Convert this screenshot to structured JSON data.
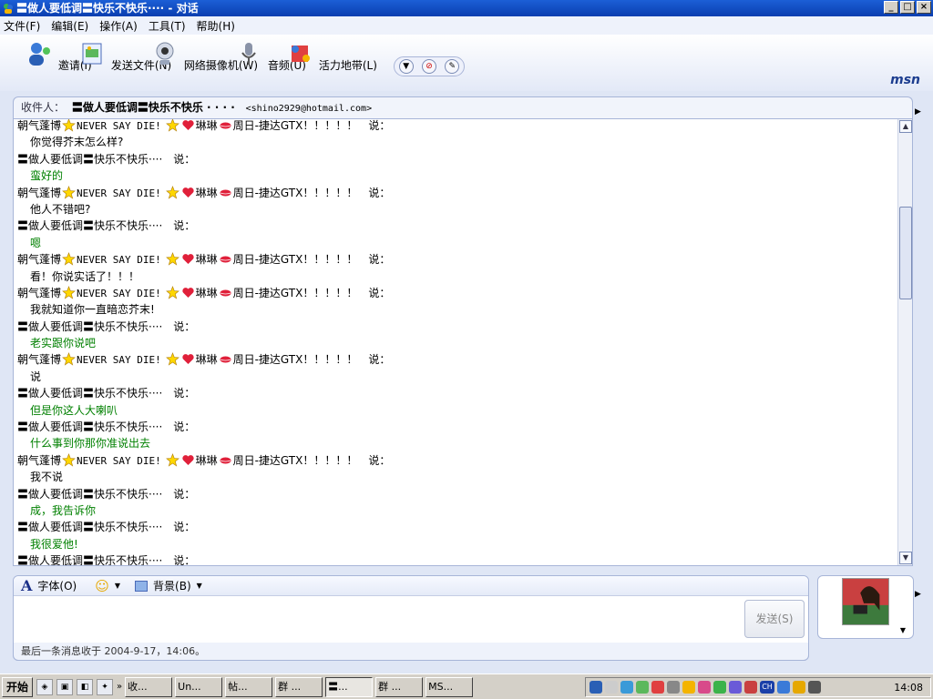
{
  "window": {
    "title": "〓做人要低调〓快乐不快乐···· - 对话"
  },
  "window_buttons": [
    "_",
    "□",
    "×"
  ],
  "menu": [
    "文件(F)",
    "编辑(E)",
    "操作(A)",
    "工具(T)",
    "帮助(H)"
  ],
  "toolbar": {
    "items": [
      "邀请(I)",
      "发送文件(N)",
      "网络摄像机(W)",
      "音频(U)",
      "活力地带(L)"
    ],
    "brand": "msn"
  },
  "recipient": {
    "label": "收件人：",
    "name": "〓做人要低调〓快乐不快乐 · · · ·",
    "email": "<shino2929@hotmail.com>"
  },
  "names": {
    "friend_a": "朝气蓬博",
    "friend_b": "NEVER SAY DIE!",
    "friend_c": "琳琳",
    "friend_d": "周日-捷达GTX！！！！！",
    "me": "〓做人要低调〓快乐不快乐····",
    "says": "说："
  },
  "messages": [
    {
      "who": "a",
      "text": "你觉得芥末怎么样?"
    },
    {
      "who": "b",
      "text": "蛮好的"
    },
    {
      "who": "a",
      "text": "他人不错吧?"
    },
    {
      "who": "b",
      "text": "嗯"
    },
    {
      "who": "a",
      "text": "看！你说实话了！！！"
    },
    {
      "who": "a",
      "text": "我就知道你一直暗恋芥末!"
    },
    {
      "who": "b",
      "text": "老实跟你说吧"
    },
    {
      "who": "a",
      "text": "说"
    },
    {
      "who": "b",
      "text": "但是你这人大喇叭"
    },
    {
      "who": "b",
      "text": "什么事到你那你准说出去"
    },
    {
      "who": "a",
      "text": "我不说"
    },
    {
      "who": "b",
      "text": "成，我告诉你"
    },
    {
      "who": "b",
      "text": "我很爱他!"
    },
    {
      "who": "b",
      "text": ""
    }
  ],
  "composer": {
    "font_label": "字体(O)",
    "background_label": "背景(B)",
    "send_label": "发送(S)",
    "status": "最后一条消息收于 2004-9-17，14:06。"
  },
  "taskbar": {
    "start": "开始",
    "tasks": [
      "收...",
      "Un...",
      "帖...",
      "群 ...",
      "〓...",
      "群 ...",
      "MS..."
    ],
    "clock": "14:08",
    "tray_ch": "CH"
  },
  "colors": {
    "reply_text": "#008000",
    "title_bar": "#0a3eb0"
  }
}
